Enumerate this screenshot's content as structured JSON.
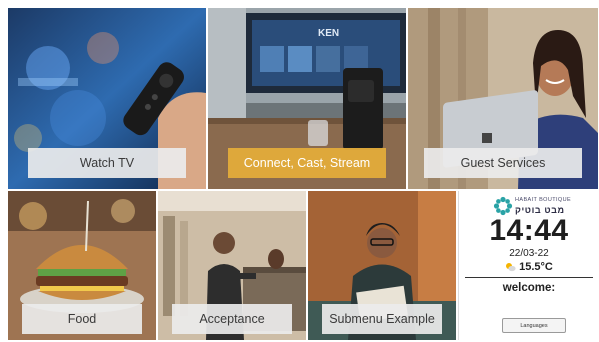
{
  "tiles": [
    {
      "id": "watch_tv",
      "label": "Watch TV"
    },
    {
      "id": "connect_cast",
      "label": "Connect, Cast, Stream"
    },
    {
      "id": "guest_services",
      "label": "Guest Services"
    },
    {
      "id": "food",
      "label": "Food"
    },
    {
      "id": "acceptance",
      "label": "Acceptance"
    },
    {
      "id": "submenu",
      "label": "Submenu Example"
    }
  ],
  "tv_screen_text": "KEN",
  "info_panel": {
    "logo_small": "HABAIT BOUTIQUE",
    "logo_name": "מבט בוטיק",
    "time": "14:44",
    "date": "22/03-22",
    "temperature": "15.5°C",
    "weather_icon": "partly-sunny-icon",
    "welcome": "welcome:",
    "languages_button": "Languages"
  },
  "colors": {
    "accent": "#e2ab3a",
    "label_bg": "#ececec",
    "label_text": "#3a3a3a",
    "logo_teal": "#2aa3a6"
  }
}
